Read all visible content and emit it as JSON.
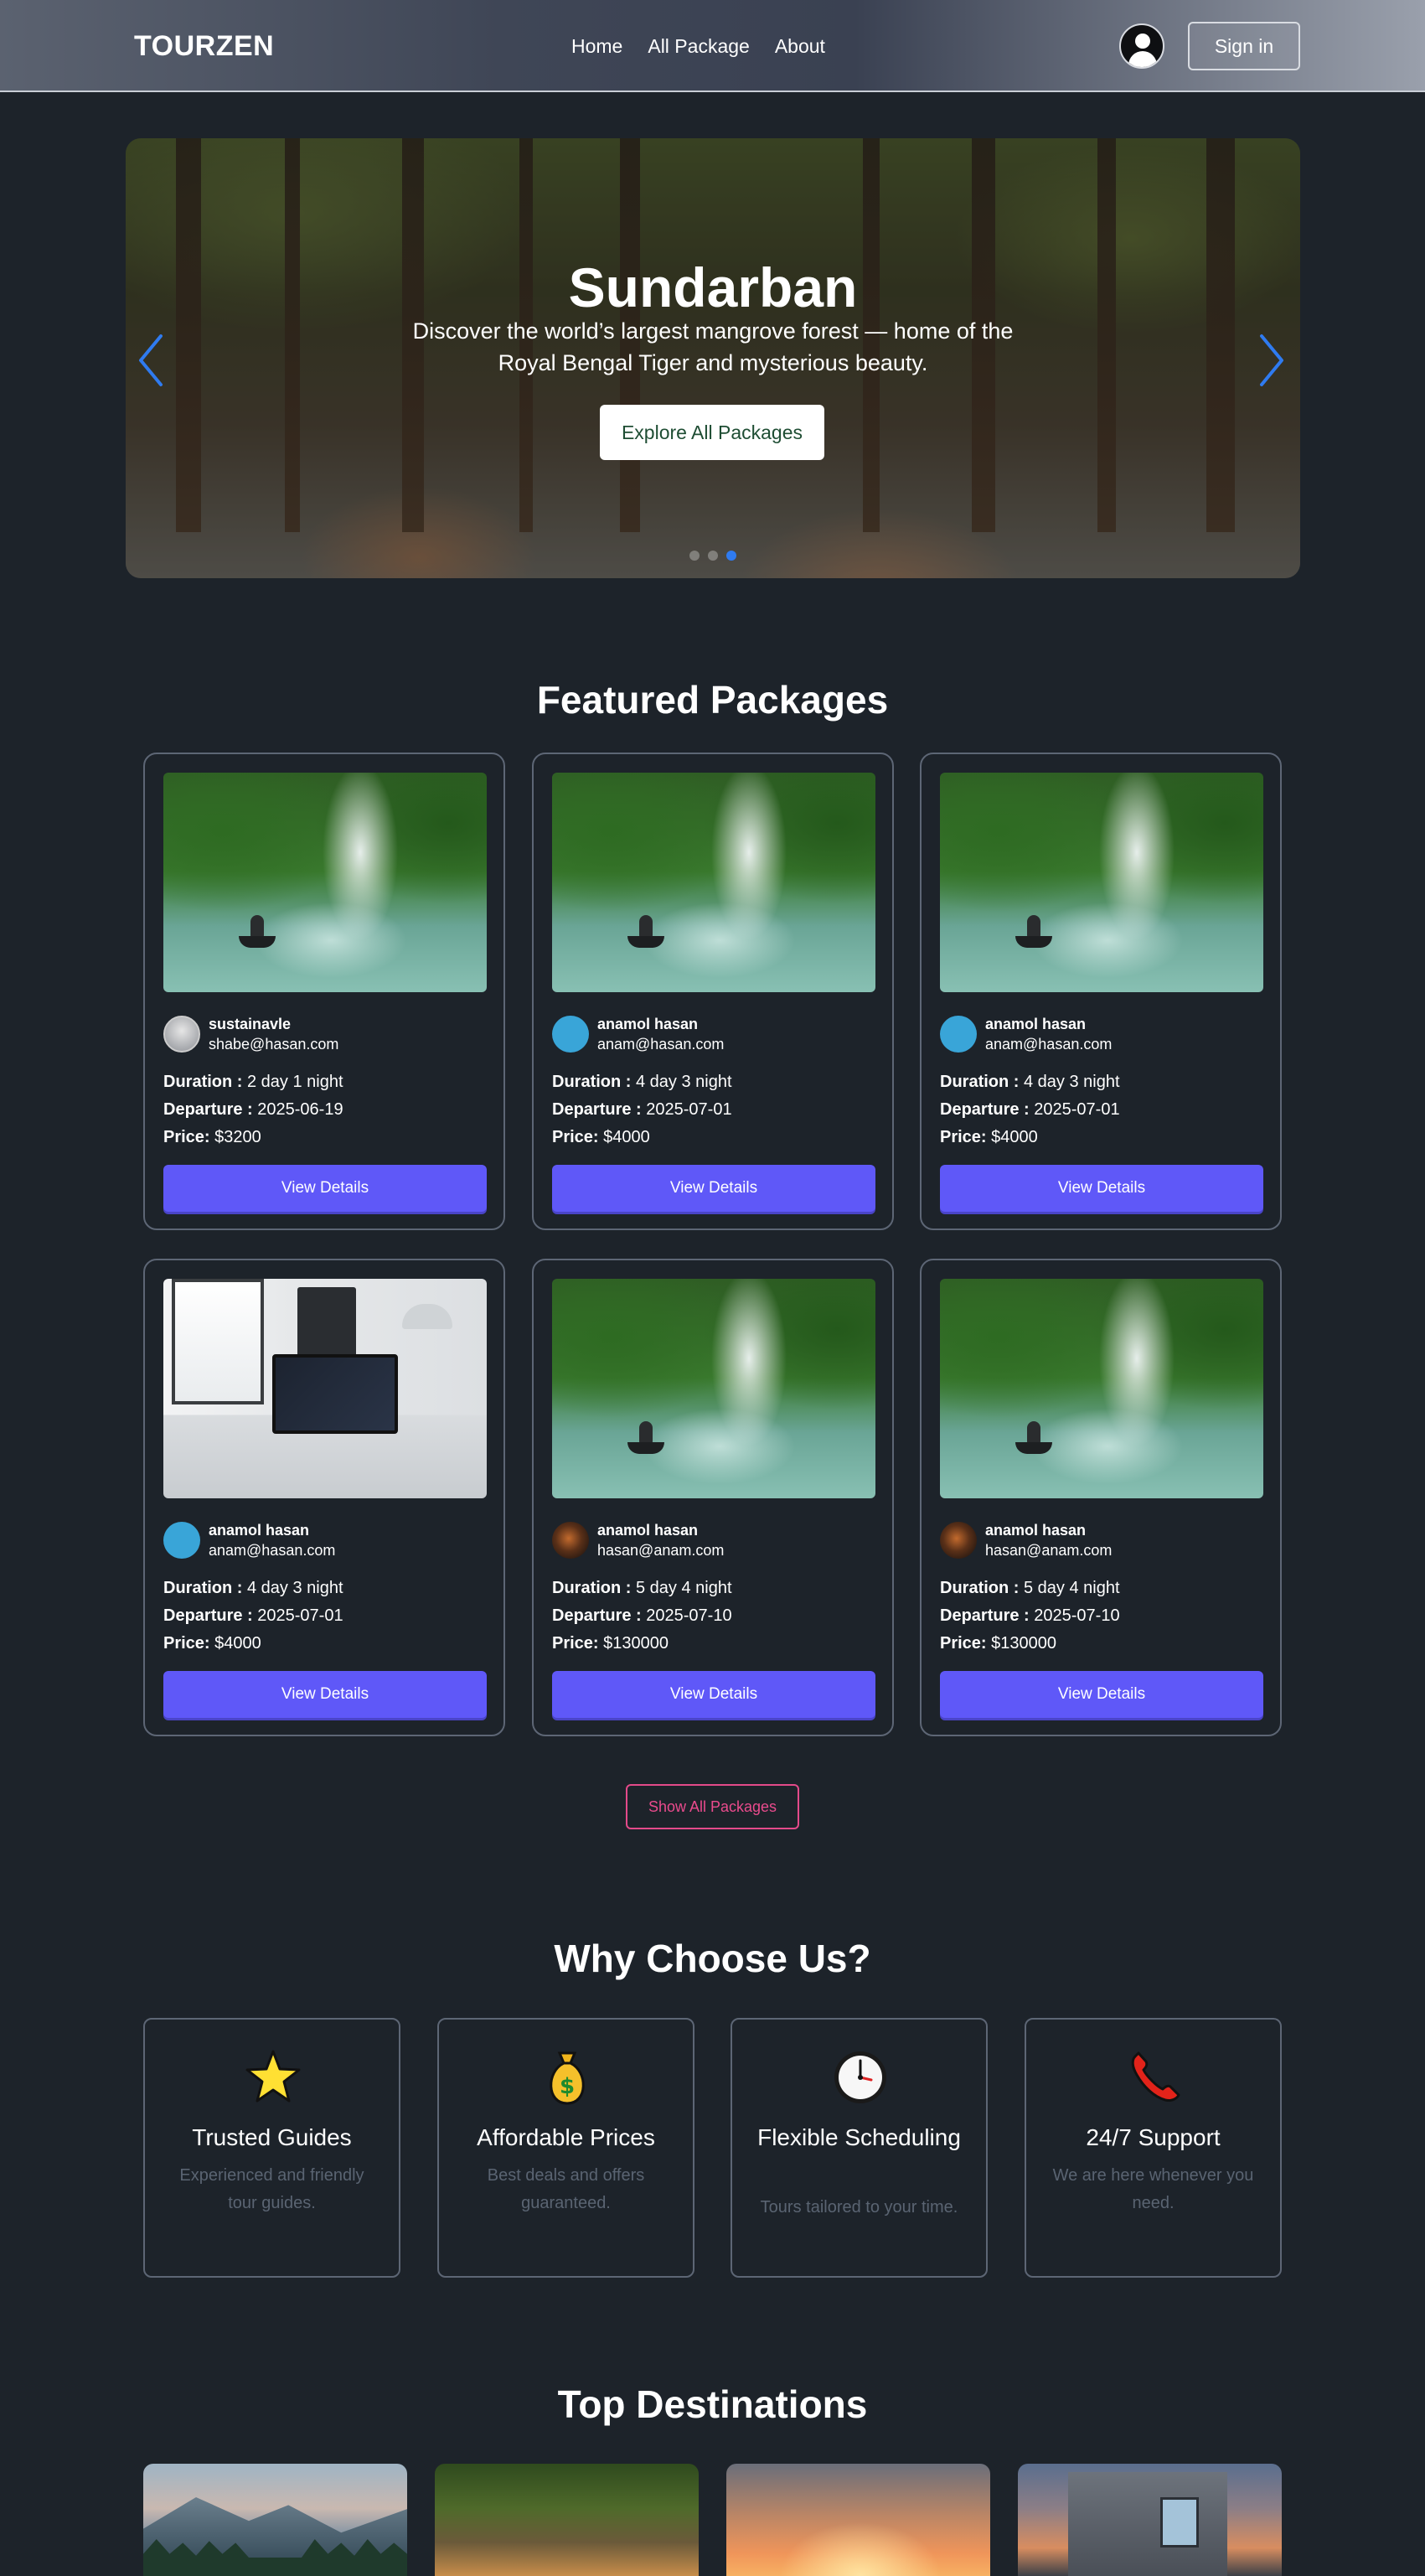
{
  "nav": {
    "brand": "TOURZEN",
    "links": [
      "Home",
      "All Package",
      "About"
    ],
    "signin": "Sign in",
    "user_icon": "user-circle-icon"
  },
  "hero": {
    "title": "Sundarban",
    "description": "Discover the world’s largest mangrove forest — home of the Royal Bengal Tiger and mysterious beauty.",
    "cta": "Explore All Packages",
    "prev_icon": "chevron-left-icon",
    "next_icon": "chevron-right-icon",
    "colors": {
      "arrow": "#2f7bf0",
      "active_dot": "#2f7bf0",
      "cta_text": "#1e4d33"
    }
  },
  "featured": {
    "title": "Featured Packages",
    "labels": {
      "duration": "Duration :",
      "departure": "Departure :",
      "price": "Price:"
    },
    "button": "View Details",
    "packages": [
      {
        "author": "sustainavle",
        "email": "shabe@hasan.com",
        "duration": "2 day 1 night",
        "departure": "2025-06-19",
        "price": "$3200"
      },
      {
        "author": "anamol hasan",
        "email": "anam@hasan.com",
        "duration": "4 day 3 night",
        "departure": "2025-07-01",
        "price": "$4000"
      },
      {
        "author": "anamol hasan",
        "email": "anam@hasan.com",
        "duration": "4 day 3 night",
        "departure": "2025-07-01",
        "price": "$4000"
      },
      {
        "author": "anamol hasan",
        "email": "anam@hasan.com",
        "duration": "4 day 3 night",
        "departure": "2025-07-01",
        "price": "$4000"
      },
      {
        "author": "anamol hasan",
        "email": "hasan@anam.com",
        "duration": "5 day 4 night",
        "departure": "2025-07-10",
        "price": "$130000"
      },
      {
        "author": "anamol hasan",
        "email": "hasan@anam.com",
        "duration": "5 day 4 night",
        "departure": "2025-07-10",
        "price": "$130000"
      }
    ],
    "show_all": "Show All Packages",
    "colors": {
      "button": "#5f58f8",
      "show_all": "#ea4b8d"
    }
  },
  "why": {
    "title": "Why Choose Us?",
    "items": [
      {
        "icon": "star-icon",
        "title": "Trusted Guides",
        "desc": "Experienced and friendly tour guides."
      },
      {
        "icon": "money-bag-icon",
        "title": "Affordable Prices",
        "desc": "Best deals and offers guaranteed."
      },
      {
        "icon": "clock-icon",
        "title": "Flexible Scheduling",
        "desc": "Tours tailored to your time."
      },
      {
        "icon": "phone-icon",
        "title": "24/7 Support",
        "desc": "We are here whenever you need."
      }
    ]
  },
  "destinations": {
    "title": "Top Destinations"
  }
}
